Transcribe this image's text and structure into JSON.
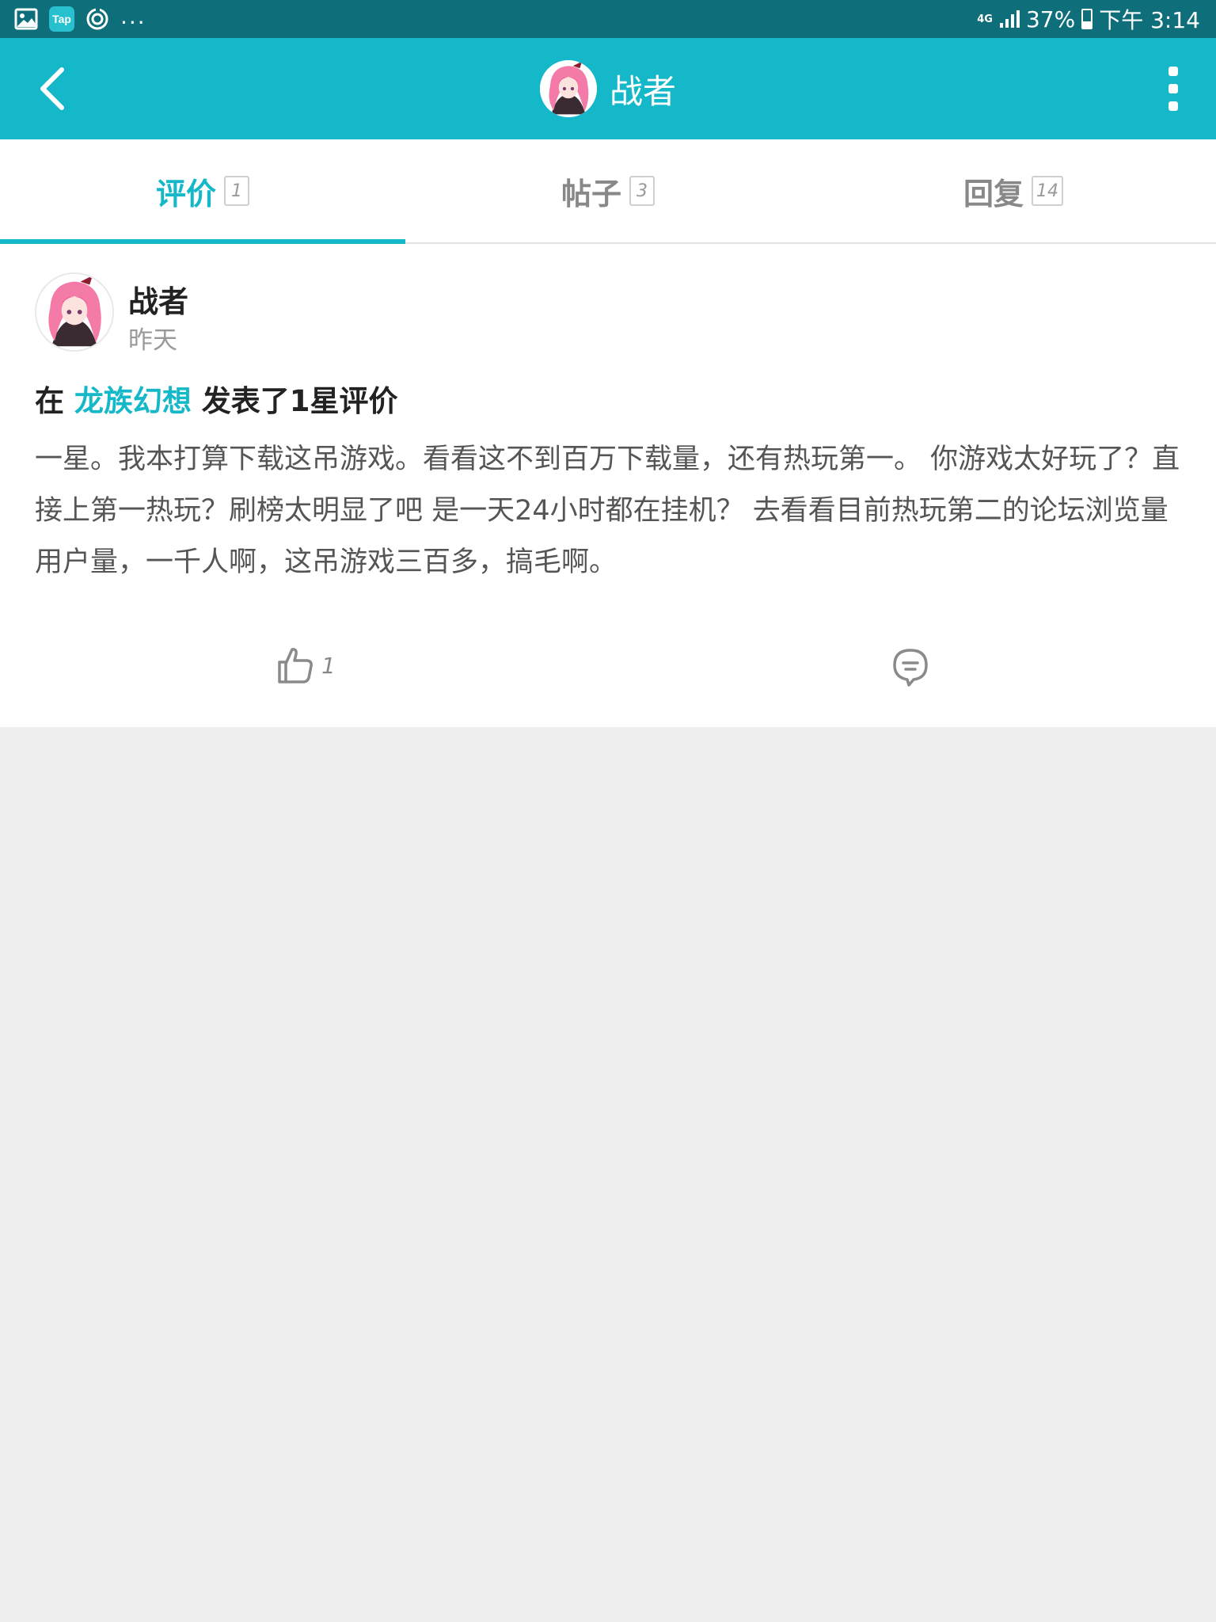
{
  "status_bar": {
    "left_icons": [
      "image-icon",
      "tap-app-icon",
      "sync-icon"
    ],
    "tap_label": "Tap",
    "more_indicator": "...",
    "network_type": "4G",
    "battery_percent": "37%",
    "battery_level": 0.37,
    "time": "下午 3:14"
  },
  "app_bar": {
    "title": "战者",
    "back_icon": "chevron-left-icon",
    "menu_icon": "more-vertical-icon"
  },
  "tabs": [
    {
      "label": "评价",
      "count": "1",
      "active": true
    },
    {
      "label": "帖子",
      "count": "3",
      "active": false
    },
    {
      "label": "回复",
      "count": "14",
      "active": false
    }
  ],
  "review": {
    "author": "战者",
    "time": "昨天",
    "action_prefix": "在",
    "game": "龙族幻想",
    "action_suffix": "发表了1星评价",
    "body": "一星。我本打算下载这吊游戏。看看这不到百万下载量，还有热玩第一。 你游戏太好玩了？直接上第一热玩？刷榜太明显了吧 是一天24小时都在挂机？ 去看看目前热玩第二的论坛浏览量用户量，一千人啊，这吊游戏三百多，搞毛啊。",
    "like_count": "1",
    "like_icon": "thumbs-up-icon",
    "comment_icon": "comment-icon"
  },
  "colors": {
    "accent": "#14b8c8",
    "status_bar": "#0e6e7a",
    "background": "#eeeeee"
  }
}
